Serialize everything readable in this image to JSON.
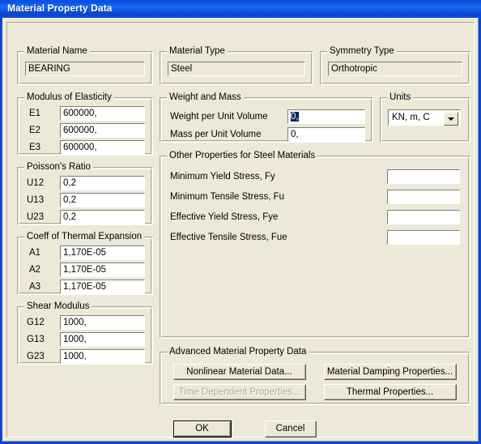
{
  "window": {
    "title": "Material Property Data",
    "accent_color": "#0a46d2",
    "face_color": "#ece9d8",
    "selection_color": "#0a246a"
  },
  "material_name": {
    "group_label": "Material Name",
    "value": "BEARING"
  },
  "material_type": {
    "group_label": "Material Type",
    "value": "Steel"
  },
  "symmetry_type": {
    "group_label": "Symmetry Type",
    "value": "Orthotropic"
  },
  "modulus_of_elasticity": {
    "group_label": "Modulus of Elasticity",
    "rows": [
      {
        "label": "E1",
        "value": "600000,"
      },
      {
        "label": "E2",
        "value": "600000,"
      },
      {
        "label": "E3",
        "value": "600000,"
      }
    ]
  },
  "poissons_ratio": {
    "group_label": "Poisson's Ratio",
    "rows": [
      {
        "label": "U12",
        "value": "0,2"
      },
      {
        "label": "U13",
        "value": "0,2"
      },
      {
        "label": "U23",
        "value": "0,2"
      }
    ]
  },
  "thermal_expansion": {
    "group_label": "Coeff of Thermal Expansion",
    "rows": [
      {
        "label": "A1",
        "value": "1,170E-05"
      },
      {
        "label": "A2",
        "value": "1,170E-05"
      },
      {
        "label": "A3",
        "value": "1,170E-05"
      }
    ]
  },
  "shear_modulus": {
    "group_label": "Shear Modulus",
    "rows": [
      {
        "label": "G12",
        "value": "1000,"
      },
      {
        "label": "G13",
        "value": "1000,"
      },
      {
        "label": "G23",
        "value": "1000,"
      }
    ]
  },
  "weight_and_mass": {
    "group_label": "Weight and Mass",
    "rows": [
      {
        "label": "Weight per Unit Volume",
        "value": "0,",
        "selected": true
      },
      {
        "label": "Mass per Unit Volume",
        "value": "0,",
        "selected": false
      }
    ]
  },
  "units": {
    "group_label": "Units",
    "selected": "KN, m, C",
    "arrow_icon": "chevron-down-icon"
  },
  "other_properties": {
    "group_label": "Other Properties for Steel Materials",
    "rows": [
      {
        "label": "Minimum Yield Stress, Fy",
        "value": ""
      },
      {
        "label": "Minimum Tensile Stress, Fu",
        "value": ""
      },
      {
        "label": "Effective Yield Stress, Fye",
        "value": ""
      },
      {
        "label": "Effective Tensile Stress, Fue",
        "value": ""
      }
    ]
  },
  "advanced": {
    "group_label": "Advanced Material Property Data",
    "buttons": [
      {
        "label": "Nonlinear Material Data...",
        "enabled": true
      },
      {
        "label": "Material Damping Properties...",
        "enabled": true
      },
      {
        "label": "Time Dependent Properties...",
        "enabled": false
      },
      {
        "label": "Thermal Properties...",
        "enabled": true
      }
    ]
  },
  "dialog_buttons": {
    "ok": "OK",
    "cancel": "Cancel"
  }
}
